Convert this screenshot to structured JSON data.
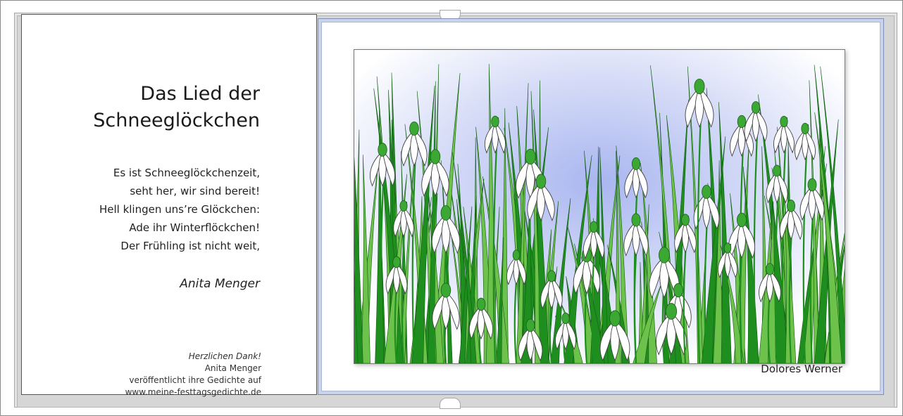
{
  "card": {
    "title_lines": [
      "Das Lied der",
      "Schneeglöckchen"
    ],
    "poem_lines": [
      "Es ist Schneeglöckchenzeit,",
      "seht her, wir sind bereit!",
      "Hell klingen uns’re Glöckchen:",
      "Ade ihr Winterflöckchen!",
      "Der Frühling ist nicht weit,"
    ],
    "author": "Anita Menger",
    "credits": [
      "Herzlichen Dank!",
      "Anita Menger",
      "veröffentlicht ihre Gedichte auf",
      "www.meine-festtagsgedichte.de"
    ]
  },
  "illustration": {
    "artist": "Dolores Werner",
    "colors": {
      "sky": "#a9b6f0",
      "leaf_dark": "#1e8f1e",
      "leaf_light": "#6cc24a",
      "petal": "#ffffff",
      "bud": "#3aa832"
    }
  }
}
